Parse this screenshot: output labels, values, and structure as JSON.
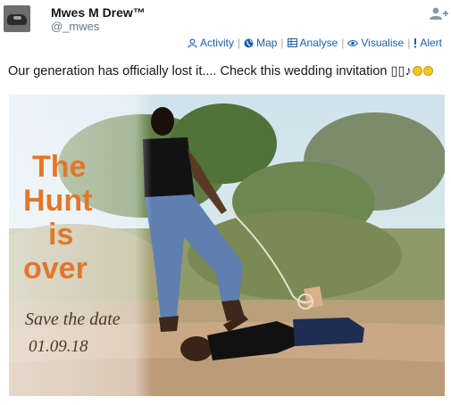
{
  "user": {
    "name": "Mwes M Drew™",
    "handle": "@_mwes"
  },
  "actions": [
    {
      "label": "Activity",
      "icon": "person-icon"
    },
    {
      "label": "Map",
      "icon": "globe-icon"
    },
    {
      "label": "Analyse",
      "icon": "table-icon"
    },
    {
      "label": "Visualise",
      "icon": "eye-icon"
    },
    {
      "label": "Alert",
      "icon": "exclamation-icon"
    }
  ],
  "tweet": {
    "text": "Our generation has officially lost it.... Check this wedding invitation ▯▯♪"
  },
  "photo": {
    "headline": [
      "The",
      "Hunt",
      "is",
      "over"
    ],
    "save_the_date": "Save the date",
    "date": "01.09.18"
  },
  "colors": {
    "link": "#1b5fa8",
    "headline": "#e3762a",
    "muted": "#657786"
  }
}
